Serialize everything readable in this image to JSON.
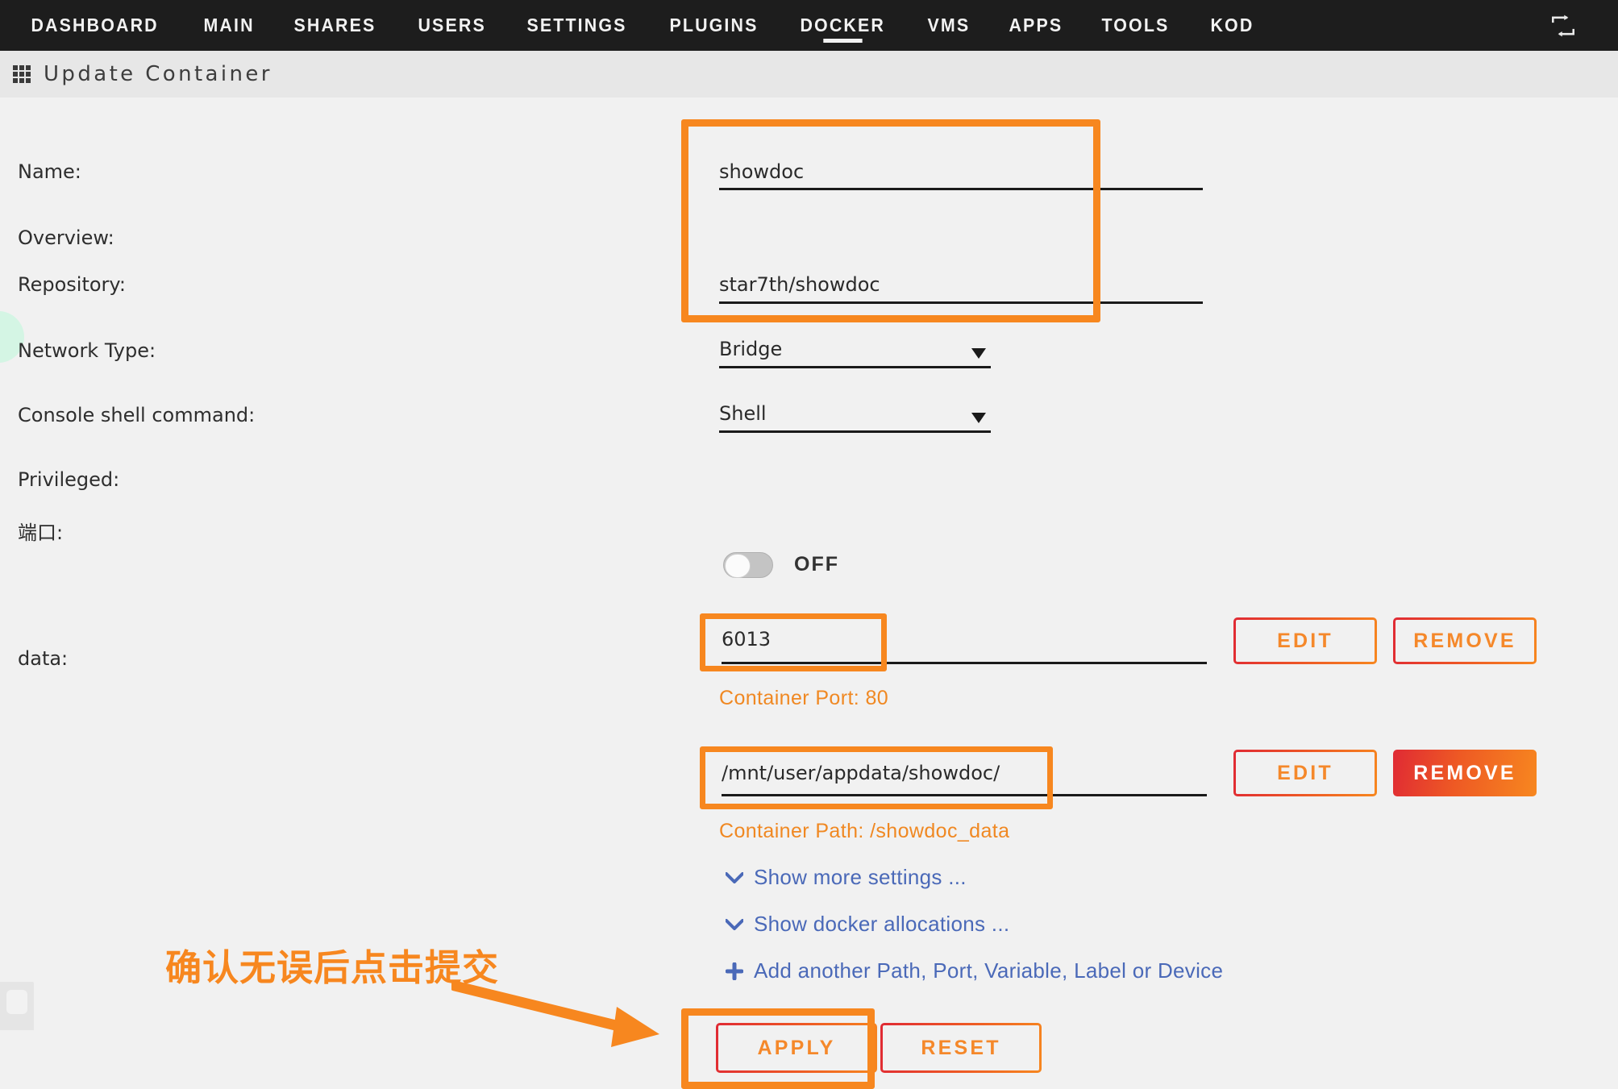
{
  "nav": {
    "items": [
      {
        "label": "DASHBOARD",
        "active": false
      },
      {
        "label": "MAIN",
        "active": false
      },
      {
        "label": "SHARES",
        "active": false
      },
      {
        "label": "USERS",
        "active": false
      },
      {
        "label": "SETTINGS",
        "active": false
      },
      {
        "label": "PLUGINS",
        "active": false
      },
      {
        "label": "DOCKER",
        "active": true
      },
      {
        "label": "VMS",
        "active": false
      },
      {
        "label": "APPS",
        "active": false
      },
      {
        "label": "TOOLS",
        "active": false
      },
      {
        "label": "KOD",
        "active": false
      }
    ],
    "refresh_icon": "repeat-icon"
  },
  "header": {
    "icon": "grid-icon",
    "title": "Update Container"
  },
  "form": {
    "labels": {
      "name": "Name:",
      "overview": "Overview:",
      "repository": "Repository:",
      "network_type": "Network Type:",
      "console_shell": "Console shell command:",
      "privileged": "Privileged:",
      "port": "端口:",
      "data": "data:"
    },
    "name_value": "showdoc",
    "repository_value": "star7th/showdoc",
    "network_type_value": "Bridge",
    "console_shell_value": "Shell",
    "privileged_state": "OFF",
    "port_value": "6013",
    "port_hint": "Container Port: 80",
    "data_value": "/mnt/user/appdata/showdoc/",
    "data_hint": "Container Path: /showdoc_data"
  },
  "row_buttons": {
    "port_edit": "EDIT",
    "port_remove": "REMOVE",
    "data_edit": "EDIT",
    "data_remove": "REMOVE"
  },
  "links": [
    {
      "label": "Show more settings ...",
      "icon": "chevron-down-icon"
    },
    {
      "label": "Show docker allocations ...",
      "icon": "chevron-down-icon"
    },
    {
      "label": "Add another Path, Port, Variable, Label or Device",
      "icon": "plus-icon"
    }
  ],
  "actions": {
    "apply": "APPLY",
    "reset": "RESET"
  },
  "annotation": {
    "text": "确认无误后点击提交",
    "arrow": "arrow-right-icon"
  },
  "colors": {
    "accent_orange": "#f7871f",
    "accent_red": "#e02a34",
    "link_blue": "#4a69b8",
    "nav_bg": "#1d1d1d",
    "page_bg": "#f1f1f1"
  }
}
